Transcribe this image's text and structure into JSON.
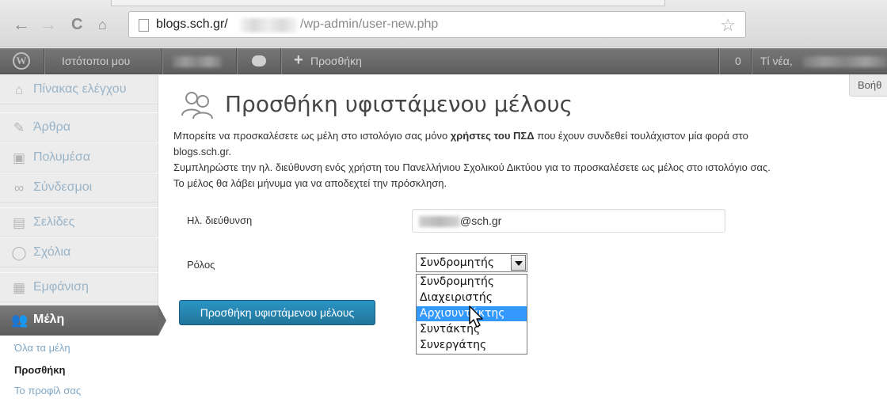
{
  "browser": {
    "url_host": "blogs.sch.gr/",
    "url_path": "/wp-admin/user-new.php"
  },
  "adminbar": {
    "sites_label": "Ιστότοποι μου",
    "new_label": "Προσθήκη",
    "count": "0",
    "greeting": "Τί νέα,"
  },
  "sidebar": {
    "items": [
      {
        "label": "Πίνακας ελέγχου",
        "icon": "home-icon"
      },
      {
        "label": "Άρθρα",
        "icon": "pin-icon"
      },
      {
        "label": "Πολυμέσα",
        "icon": "media-icon"
      },
      {
        "label": "Σύνδεσμοι",
        "icon": "link-icon"
      },
      {
        "label": "Σελίδες",
        "icon": "pages-icon"
      },
      {
        "label": "Σχόλια",
        "icon": "comments-icon"
      },
      {
        "label": "Εμφάνιση",
        "icon": "appearance-icon"
      },
      {
        "label": "Μέλη",
        "icon": "users-icon"
      }
    ],
    "submenu": [
      "Όλα τα μέλη",
      "Προσθήκη",
      "Το προφίλ σας"
    ]
  },
  "main": {
    "help_label": "Βοήθ",
    "title": "Προσθήκη υφιστάμενου μέλους",
    "desc_line1_pre": "Μπορείτε να προσκαλέσετε ως μέλη στο ιστολόγιο σας μόνο ",
    "desc_line1_bold": "χρήστες του ΠΣΔ",
    "desc_line1_post": " που έχουν συνδεθεί τουλάχιστον μία φορά στο",
    "desc_line2": "blogs.sch.gr.",
    "desc_line3": "Συμπληρώστε την ηλ. διεύθυνση ενός χρήστη του Πανελλήνιου Σχολικού Δικτύου για το προσκαλέσετε ως μέλος στο ιστολόγιο σας.",
    "desc_line4": "Το μέλος θα λάβει μήνυμα για να αποδεχτεί την πρόσκληση.",
    "email_label": "Ηλ. διεύθυνση",
    "email_value": "@sch.gr",
    "role_label": "Ρόλος",
    "role_selected": "Συνδρομητής",
    "role_options": [
      "Συνδρομητής",
      "Διαχειριστής",
      "Αρχισυντάκτης",
      "Συντάκτης",
      "Συνεργάτης"
    ],
    "hovered_option": "Αρχισυντάκτης",
    "submit_label": "Προσθήκη υφιστάμενου μέλους"
  },
  "colors": {
    "accent_button": "#21759b",
    "selected_option": "#3399ff",
    "menu_link": "#9ab4c8"
  }
}
